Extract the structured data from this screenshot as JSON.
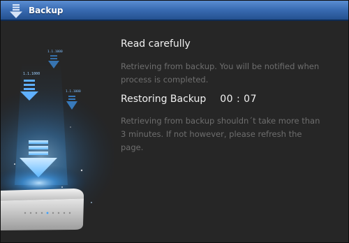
{
  "window": {
    "title": "Backup",
    "title_icon": "download-arrow-icon"
  },
  "illustration": {
    "labels": [
      "1.1.1000",
      "1.1.1000",
      "1.1.1000"
    ],
    "icons": [
      "download-arrow-icon",
      "router-device-icon"
    ]
  },
  "main": {
    "heading": "Read carefully",
    "note1": "Retrieving from backup. You will be notified when process is completed.",
    "restoring_label": "Restoring Backup",
    "timer": "00 : 07",
    "note2": "Retrieving from backup shouldn´t take more than 3 minutes. If not however, please refresh the page."
  },
  "colors": {
    "titlebar": "#3a6db4",
    "background": "#262626",
    "heading": "#f1f1f1",
    "muted_text": "#6e6e6e",
    "glow": "#4fb2ff"
  }
}
